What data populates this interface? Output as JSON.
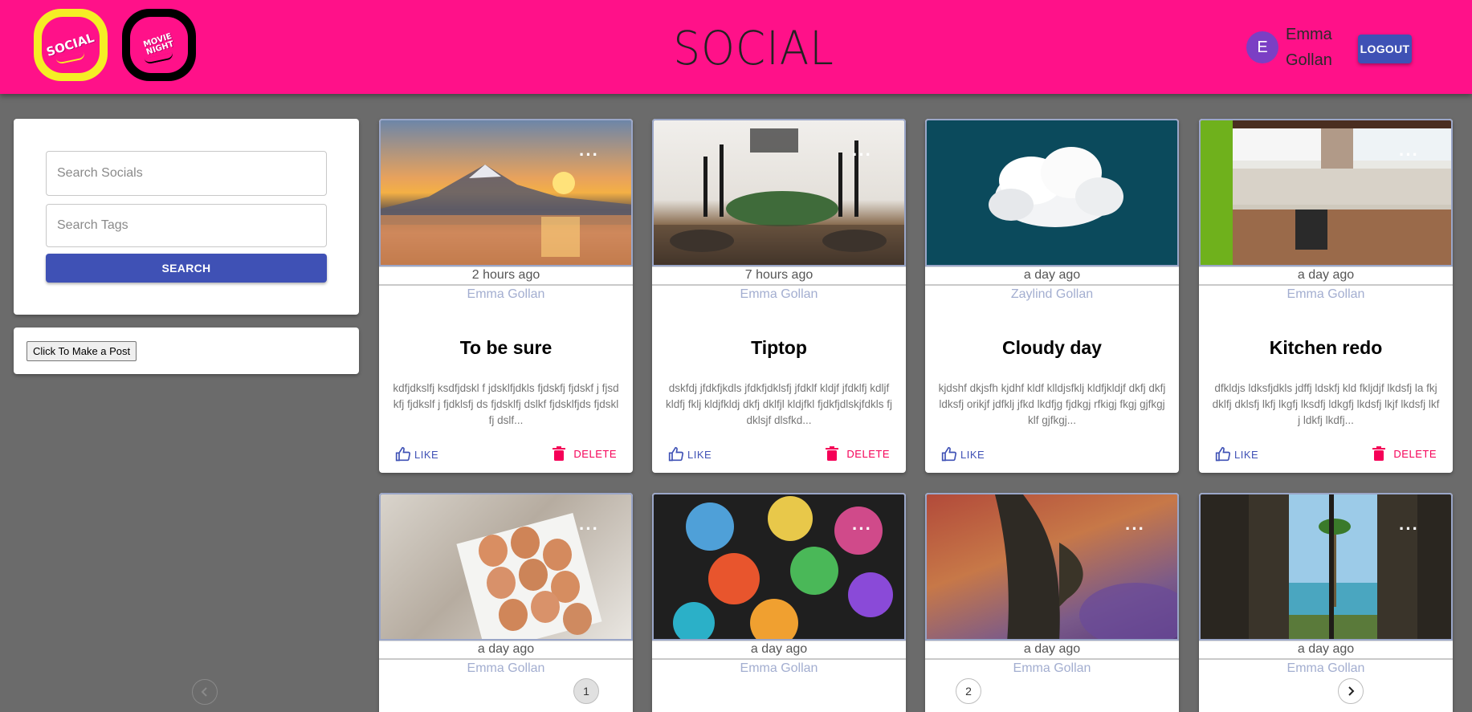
{
  "header": {
    "title": "SOCIAL",
    "logo_social_text": "SOCIAL",
    "logo_movie_text": "MOVIE NIGHT",
    "user_initial": "E",
    "user_name": "Emma Gollan",
    "logout_label": "LOGOUT"
  },
  "sidebar": {
    "search_socials_placeholder": "Search Socials",
    "search_tags_placeholder": "Search Tags",
    "search_label": "SEARCH",
    "make_post_label": "Click To Make a Post"
  },
  "posts": [
    {
      "time": "2 hours ago",
      "author": "Emma Gollan",
      "title": "To be sure",
      "text": "kdfjdkslfj ksdfjdskl f jdsklfjdkls fjdskfj fjdskf j fjsdkfj fjdkslf j fjdklsfj ds fjdsklfj dslkf fjdsklfjds fjdsklfj dslf...",
      "like": "LIKE",
      "delete": "DELETE"
    },
    {
      "time": "7 hours ago",
      "author": "Emma Gollan",
      "title": "Tiptop",
      "text": "dskfdj jfdkfjkdls jfdkfjdklsfj jfdklf kldjf jfdklfj kdljf kldfj fklj kldjfkldj dkfj dklfjl kldjfkl fjdkfjdlskjfdkls fjdklsjf dlsfkd...",
      "like": "LIKE",
      "delete": "DELETE"
    },
    {
      "time": "a day ago",
      "author": "Zaylind Gollan",
      "title": "Cloudy day",
      "text": "kjdshf dkjsfh kjdhf kldf klldjsfklj kldfjkldjf dkfj dkfj ldksfj orikjf jdfklj jfkd lkdfjg fjdkgj rfkigj fkgj gjfkgj klf gjfkgj...",
      "like": "LIKE",
      "delete": ""
    },
    {
      "time": "a day ago",
      "author": "Emma Gollan",
      "title": "Kitchen redo",
      "text": "dfkldjs ldksfjdkls jdffj ldskfj kld fkljdjf lkdsfj la fkjdklfj dklsfj lkfj lkgfj lksdfj ldkgfj lkdsfj lkjf lkdsfj lkfj ldkfj lkdfj...",
      "like": "LIKE",
      "delete": "DELETE"
    },
    {
      "time": "a day ago",
      "author": "Emma Gollan"
    },
    {
      "time": "a day ago",
      "author": "Emma Gollan"
    },
    {
      "time": "a day ago",
      "author": "Emma Gollan"
    },
    {
      "time": "a day ago",
      "author": "Emma Gollan"
    }
  ],
  "pagination": {
    "page_1": "1",
    "page_2": "2",
    "current_page": 1
  }
}
